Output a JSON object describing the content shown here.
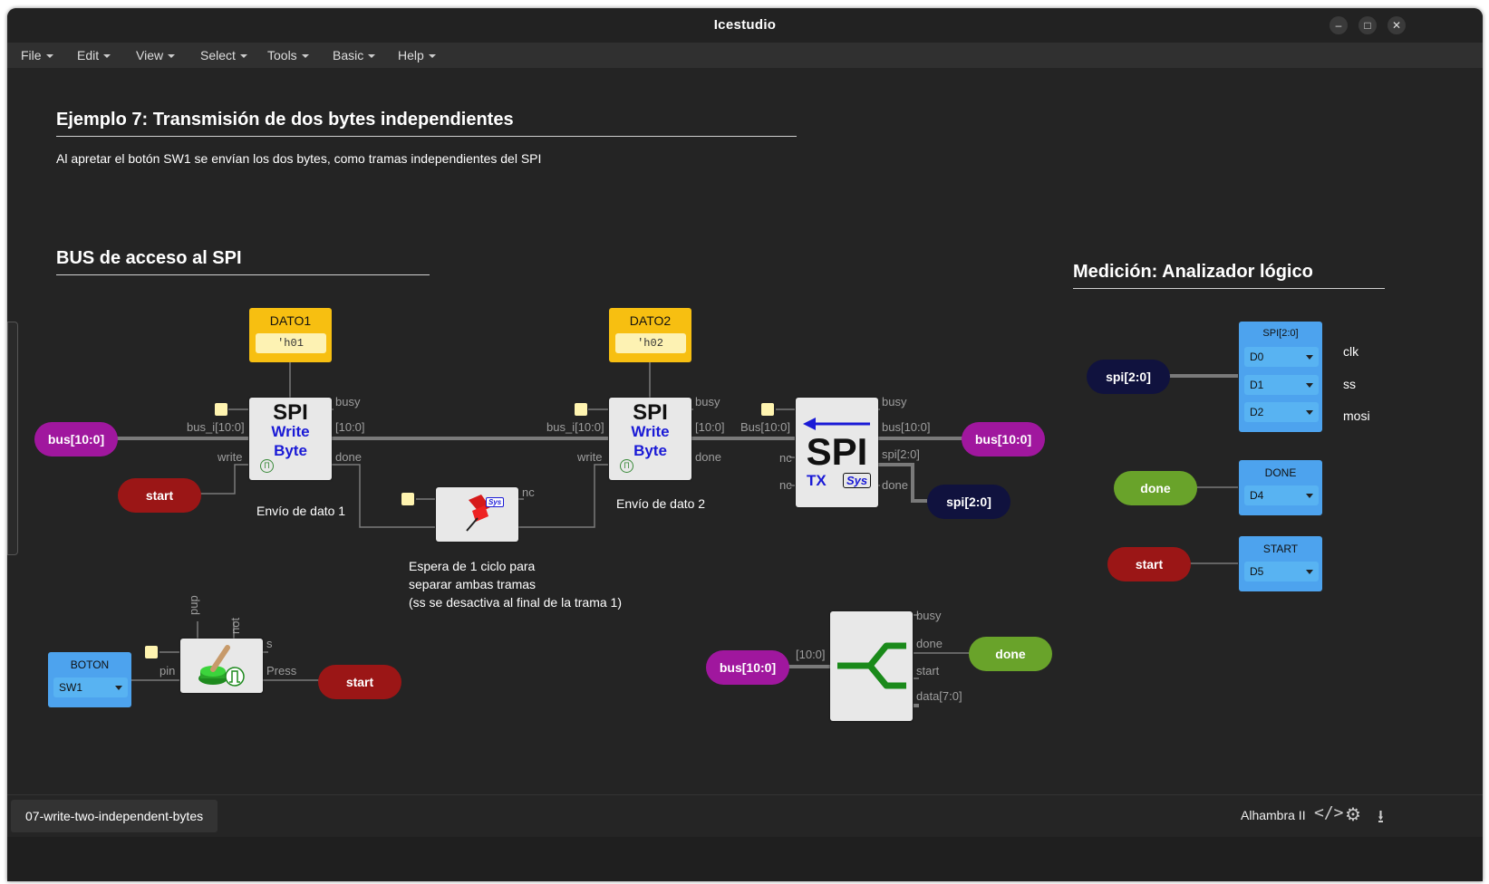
{
  "window": {
    "title": "Icestudio"
  },
  "menu": [
    "File",
    "Edit",
    "View",
    "Select",
    "Tools",
    "Basic",
    "Help"
  ],
  "canvas": {
    "title1": "Ejemplo 7: Transmisión de dos bytes independientes",
    "desc1": "Al apretar el botón SW1 se envían los dos bytes, como tramas independientes del SPI",
    "title2": "BUS de acceso al SPI",
    "title3": "Medición: Analizador lógico",
    "const1": {
      "name": "DATO1",
      "value": "'h01"
    },
    "const2": {
      "name": "DATO2",
      "value": "'h02"
    },
    "spi_write": {
      "l1": "SPI",
      "l2": "Write",
      "l3": "Byte"
    },
    "spi_tx": {
      "big": "SPI",
      "tx": "TX",
      "sys": "Sys"
    },
    "wait_sys": "Sys",
    "ports": {
      "busy": "busy",
      "bus_i": "bus_i[10:0]",
      "bus_o": "[10:0]",
      "write": "write",
      "done": "done",
      "nc": "nc",
      "bus_in": "Bus[10:0]",
      "bus_out": "bus[10:0]",
      "spi_out": "spi[2:0]",
      "pup": "pup",
      "not": "not",
      "s": "s",
      "pin": "pin",
      "press": "Press",
      "split_in": "[10:0]",
      "start": "start",
      "data": "data[7:0]"
    },
    "labels": {
      "envio1": "Envío de dato 1",
      "envio2": "Envío de dato 2",
      "espera1": "Espera de 1 ciclo para",
      "espera2": "separar ambas tramas",
      "espera3": "(ss se desactiva al final de la trama 1)"
    },
    "tags": {
      "bus": "bus[10:0]",
      "start": "start",
      "spi": "spi[2:0]",
      "done": "done"
    },
    "boton": {
      "name": "BOTON",
      "value": "SW1"
    },
    "analyzer": {
      "spi": {
        "name": "SPI[2:0]",
        "pins": [
          "D0",
          "D1",
          "D2"
        ]
      },
      "done": {
        "name": "DONE",
        "pin": "D4"
      },
      "start": {
        "name": "START",
        "pin": "D5"
      },
      "signals": [
        "clk",
        "ss",
        "mosi"
      ]
    }
  },
  "status": {
    "file": "07-write-two-independent-bytes",
    "board": "Alhambra II"
  },
  "colors": {
    "bus": "#a0179e",
    "start": "#9b1616",
    "spi": "#10123e",
    "done": "#69a32a",
    "const": "#f7bf11",
    "pin": "#4da3ee",
    "spi_text": "#1a1ad6"
  }
}
